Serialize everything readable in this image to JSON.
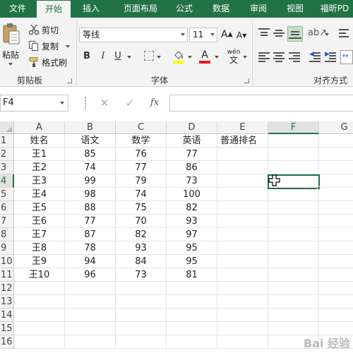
{
  "tabs": [
    "文件",
    "开始",
    "插入",
    "页面布局",
    "公式",
    "数据",
    "审阅",
    "视图",
    "福昕PD"
  ],
  "active_tab": "开始",
  "clipboard": {
    "paste_label": "粘贴",
    "cut_label": "剪切",
    "copy_label": "复制",
    "format_painter_label": "格式刷",
    "group_label": "剪贴板"
  },
  "font": {
    "font_name": "等线",
    "font_size": "11",
    "grow_label": "A",
    "shrink_label": "A",
    "bold_label": "B",
    "italic_label": "I",
    "underline_label": "U",
    "fill_label": "",
    "color_label": "A",
    "phonetic_top": "wén",
    "phonetic_bottom": "文",
    "group_label": "字体"
  },
  "alignment": {
    "group_label": "对齐方式"
  },
  "formula_bar": {
    "name_box": "F4",
    "cancel": "✕",
    "confirm": "✓",
    "fx": "fx",
    "formula": ""
  },
  "columns": [
    "A",
    "B",
    "C",
    "D",
    "E",
    "F",
    "G"
  ],
  "selected_column": "F",
  "rows": [
    "1",
    "2",
    "3",
    "4",
    "5",
    "6",
    "7",
    "8",
    "9",
    "10",
    "11",
    "12",
    "13",
    "14",
    "15",
    "16"
  ],
  "selected_row": "4",
  "headers": [
    "姓名",
    "语文",
    "数学",
    "英语",
    "普通排名"
  ],
  "table": [
    [
      "王1",
      "85",
      "76",
      "77"
    ],
    [
      "王2",
      "74",
      "77",
      "86"
    ],
    [
      "王3",
      "99",
      "79",
      "73"
    ],
    [
      "王4",
      "98",
      "74",
      "100"
    ],
    [
      "王5",
      "88",
      "75",
      "82"
    ],
    [
      "王6",
      "77",
      "70",
      "93"
    ],
    [
      "王7",
      "87",
      "82",
      "97"
    ],
    [
      "王8",
      "78",
      "93",
      "95"
    ],
    [
      "王9",
      "94",
      "84",
      "95"
    ],
    [
      "王10",
      "96",
      "73",
      "81"
    ]
  ],
  "accent_color": "#217346",
  "watermark": "Bai 经验"
}
